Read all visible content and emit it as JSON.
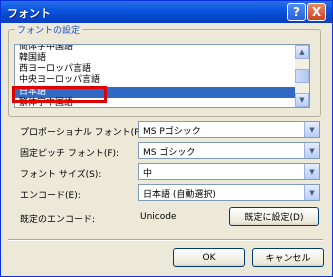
{
  "window": {
    "title": "フォント"
  },
  "title_buttons": {
    "help": "?",
    "close": "X"
  },
  "font_settings": {
    "label": "フォントの設定",
    "items": [
      "簡体字中国語",
      "韓国語",
      "西ヨーロッパ言語",
      "中央ヨーロッパ言語",
      "日本語",
      "繁体字中国語"
    ],
    "selected_index": 4
  },
  "fields": {
    "proportional": {
      "label": "プロポーショナル フォント(P):",
      "value": "MS Pゴシック"
    },
    "fixed": {
      "label": "固定ピッチ フォント(F):",
      "value": "MS ゴシック"
    },
    "size": {
      "label": "フォント サイズ(S):",
      "value": "中"
    },
    "encoding": {
      "label": "エンコード(E):",
      "value": "日本語 (自動選択)"
    },
    "default_encoding": {
      "label": "既定のエンコード:",
      "value": "Unicode"
    }
  },
  "buttons": {
    "set_default": "既定に設定(D)",
    "ok": "OK",
    "cancel": "キャンセル"
  },
  "colors": {
    "selection": "#316ac5",
    "highlight_box": "#e10000",
    "title_bar": "#0a56e0"
  }
}
